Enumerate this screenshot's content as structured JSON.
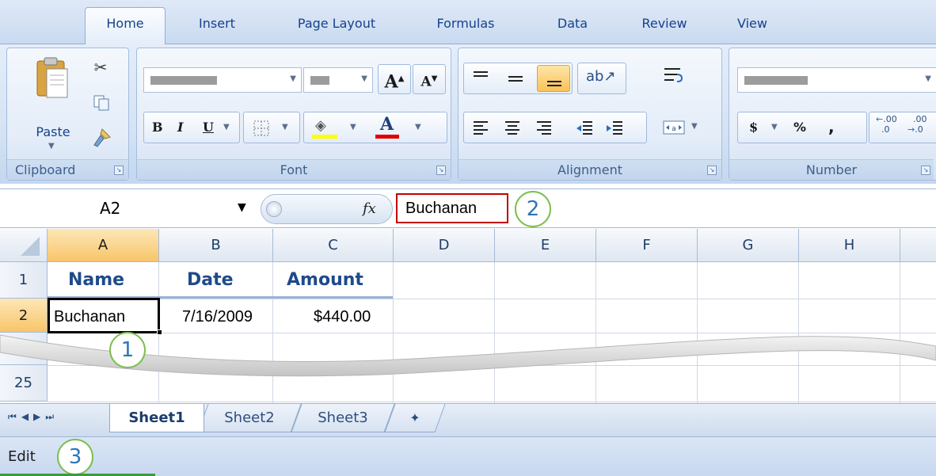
{
  "ribbon_tabs": [
    "Home",
    "Insert",
    "Page Layout",
    "Formulas",
    "Data",
    "Review",
    "View"
  ],
  "groups": {
    "clipboard": {
      "label": "Clipboard",
      "paste": "Paste"
    },
    "font": {
      "label": "Font",
      "bold": "B",
      "italic": "I",
      "underline": "U",
      "grow": "A",
      "shrink": "A",
      "font_color": "A"
    },
    "alignment": {
      "label": "Alignment"
    },
    "number": {
      "label": "Number",
      "currency": "$",
      "percent": "%",
      "comma": ",",
      "inc_decimal": ".00",
      "dec_decimal": ".00"
    }
  },
  "formula_bar": {
    "name_box": "A2",
    "fx": "fx",
    "content": "Buchanan"
  },
  "columns": [
    "A",
    "B",
    "C",
    "D",
    "E",
    "F",
    "G",
    "H"
  ],
  "rows": [
    "1",
    "2",
    "25"
  ],
  "cells": {
    "a1": "Name",
    "b1": "Date",
    "c1": "Amount",
    "a2": "Buchanan",
    "b2": "7/16/2009",
    "c2": "$440.00"
  },
  "callouts": [
    "1",
    "2",
    "3"
  ],
  "sheets": [
    "Sheet1",
    "Sheet2",
    "Sheet3"
  ],
  "status": {
    "mode": "Edit"
  },
  "colors": {
    "accent": "#15428b",
    "callout_ring": "#7cbf4f",
    "callout_text": "#2b76b9",
    "formula_highlight": "#c00000"
  }
}
